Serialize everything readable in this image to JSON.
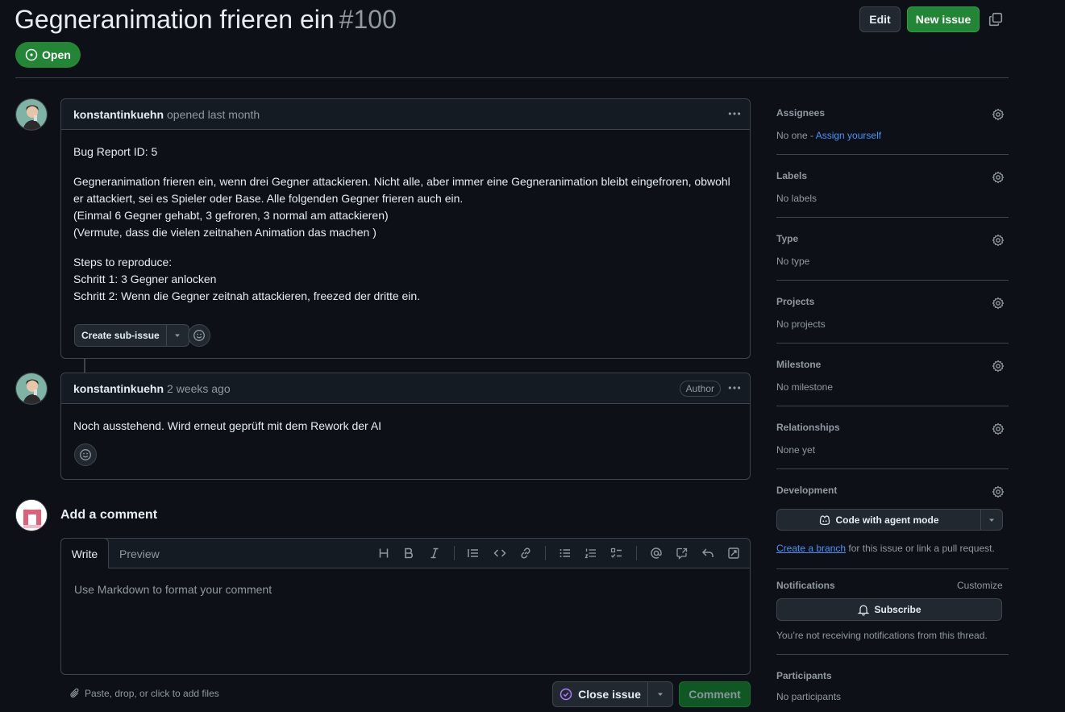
{
  "issue": {
    "title": "Gegneranimation frieren ein",
    "number": "#100",
    "state": "Open"
  },
  "header": {
    "edit_label": "Edit",
    "new_issue_label": "New issue"
  },
  "comments": [
    {
      "author": "konstantinkuehn",
      "when": "opened last month",
      "body": [
        "Bug Report ID: 5",
        "Gegneranimation frieren ein, wenn drei Gegner attackieren. Nicht alle, aber immer eine Gegneranimation bleibt eingefroren, obwohl er attackiert, sei es Spieler oder Base. Alle folgenden Gegner frieren auch ein.",
        "(Einmal 6 Gegner gehabt, 3 gefroren, 3 normal am attackieren)",
        "(Vermute, dass die vielen zeitnahen Animation das machen )",
        "Steps to reproduce:",
        "Schritt 1: 3 Gegner anlocken",
        "Schritt 2: Wenn die Gegner zeitnah attackieren, freezed der dritte ein."
      ],
      "sub_issue_label": "Create sub-issue"
    },
    {
      "author": "konstantinkuehn",
      "when": "2 weeks ago",
      "badge": "Author",
      "body": [
        "Noch ausstehend. Wird erneut geprüft mit dem Rework der AI"
      ]
    }
  ],
  "composer": {
    "title": "Add a comment",
    "tab_write": "Write",
    "tab_preview": "Preview",
    "placeholder": "Use Markdown to format your comment",
    "attach_text": "Paste, drop, or click to add files",
    "close_issue_label": "Close issue",
    "comment_label": "Comment"
  },
  "sidebar": {
    "assignees": {
      "title": "Assignees",
      "value": "No one - ",
      "link": "Assign yourself"
    },
    "labels": {
      "title": "Labels",
      "value": "No labels"
    },
    "type": {
      "title": "Type",
      "value": "No type"
    },
    "projects": {
      "title": "Projects",
      "value": "No projects"
    },
    "milestone": {
      "title": "Milestone",
      "value": "No milestone"
    },
    "relationships": {
      "title": "Relationships",
      "value": "None yet"
    },
    "development": {
      "title": "Development",
      "agent_label": "Code with agent mode",
      "branch_link": "Create a branch",
      "branch_text": " for this issue or link a pull request."
    },
    "notifications": {
      "title": "Notifications",
      "customize": "Customize",
      "subscribe": "Subscribe",
      "status": "You’re not receiving notifications from this thread."
    },
    "participants": {
      "title": "Participants",
      "value": "No participants"
    }
  },
  "colors": {
    "background": "#0d1117",
    "open_green": "#238636",
    "link_blue": "#4493f8",
    "border": "#3d444d"
  }
}
